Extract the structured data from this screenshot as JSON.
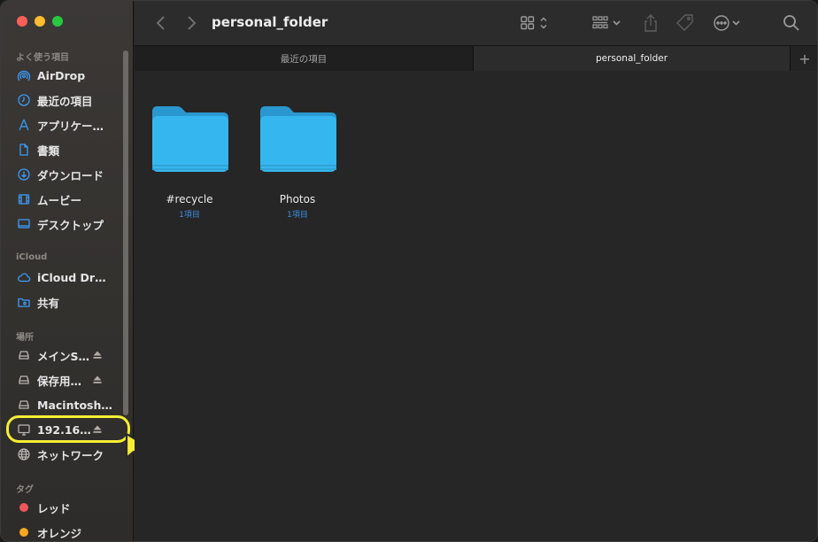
{
  "window": {
    "title": "personal_folder"
  },
  "sidebar": {
    "favorites_header": "よく使う項目",
    "favorites": [
      {
        "label": "AirDrop",
        "icon": "airdrop-icon"
      },
      {
        "label": "最近の項目",
        "icon": "clock-icon"
      },
      {
        "label": "アプリケー…",
        "icon": "applications-icon"
      },
      {
        "label": "書類",
        "icon": "document-icon"
      },
      {
        "label": "ダウンロード",
        "icon": "download-icon"
      },
      {
        "label": "ムービー",
        "icon": "film-icon"
      },
      {
        "label": "デスクトップ",
        "icon": "desktop-icon"
      }
    ],
    "icloud_header": "iCloud",
    "icloud": [
      {
        "label": "iCloud Drive",
        "icon": "cloud-icon"
      },
      {
        "label": "共有",
        "icon": "shared-folder-icon"
      }
    ],
    "locations_header": "場所",
    "locations": [
      {
        "label": "メインS…",
        "icon": "drive-icon",
        "eject": true
      },
      {
        "label": "保存用…",
        "icon": "drive-icon",
        "eject": true
      },
      {
        "label": "Macintosh…",
        "icon": "drive-icon",
        "eject": false
      },
      {
        "label": "192.16…",
        "icon": "server-icon",
        "eject": true
      },
      {
        "label": "ネットワーク",
        "icon": "network-globe-icon",
        "eject": false
      }
    ],
    "tags_header": "タグ",
    "tags": [
      {
        "label": "レッド",
        "color": "#f0545c"
      },
      {
        "label": "オレンジ",
        "color": "#f5a623"
      }
    ]
  },
  "tabs": [
    {
      "label": "最近の項目",
      "active": false
    },
    {
      "label": "personal_folder",
      "active": true
    }
  ],
  "tab_add_label": "+",
  "folders": [
    {
      "name": "#recycle",
      "count": "1項目"
    },
    {
      "name": "Photos",
      "count": "1項目"
    }
  ],
  "colors": {
    "folder": "#36b6ee",
    "accent": "#3d9bf5",
    "highlight": "#f5ee34"
  }
}
